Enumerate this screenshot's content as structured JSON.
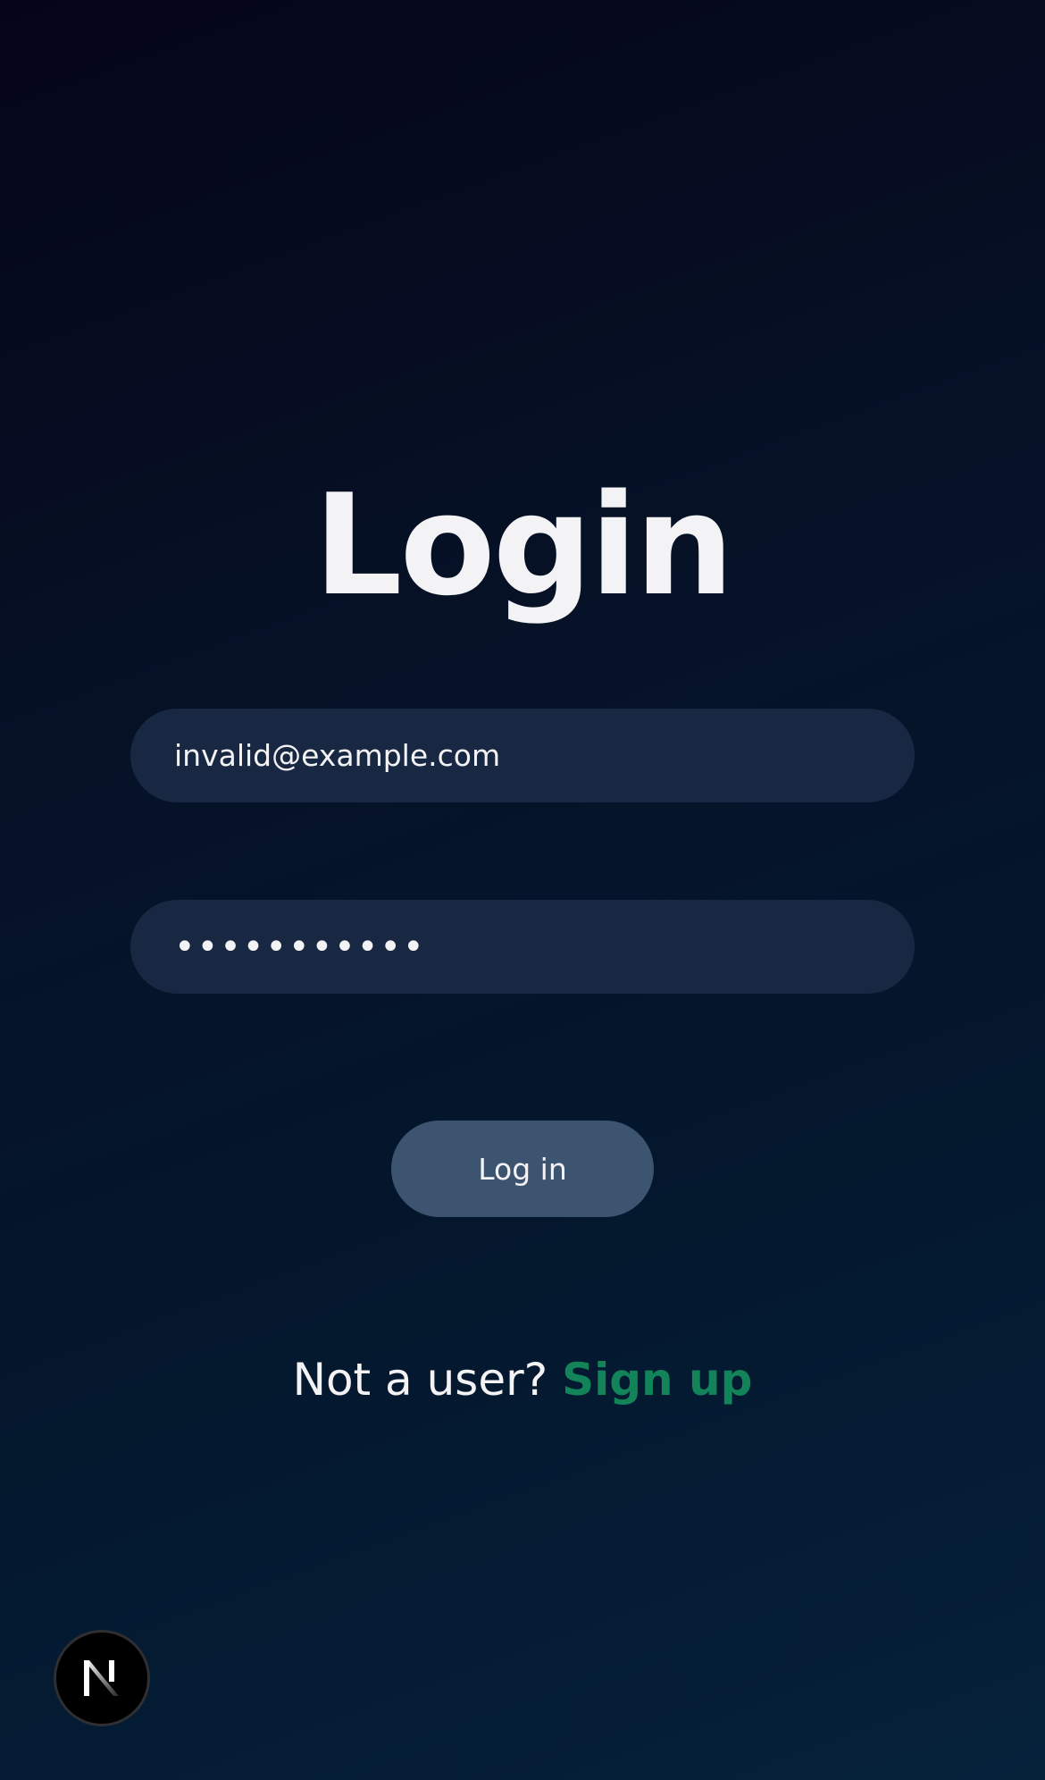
{
  "page": {
    "title": "Login"
  },
  "form": {
    "email_value": "invalid@example.com",
    "password_value": "•••••••••••",
    "submit_label": "Log in"
  },
  "signup": {
    "prompt": "Not a user?",
    "link_label": "Sign up"
  },
  "badge": {
    "icon": "nextjs-logo-icon",
    "letter": "N"
  },
  "colors": {
    "background_top": "#050519",
    "background_bottom": "#05213a",
    "field_background": "#182842",
    "button_background": "#3d5470",
    "link": "#13845a",
    "text": "#f3f3f5"
  }
}
